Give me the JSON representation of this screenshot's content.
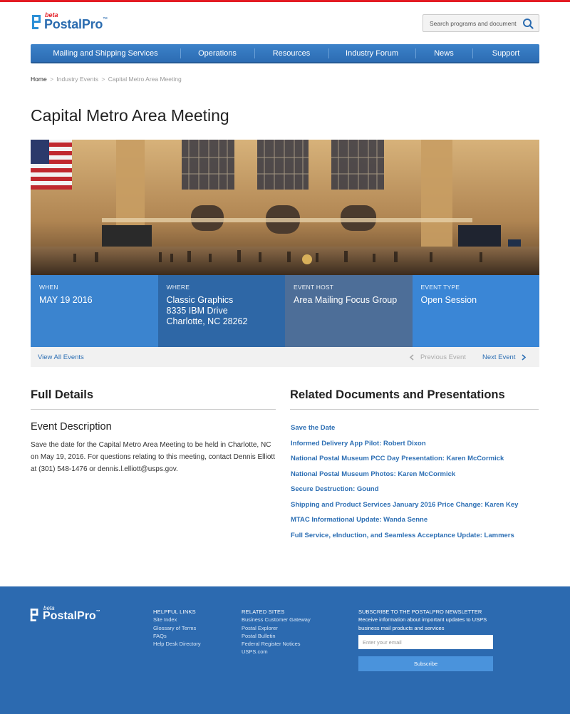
{
  "brand": {
    "beta": "beta",
    "name": "PostalPro",
    "tm": "™"
  },
  "search": {
    "placeholder": "Search programs and documents"
  },
  "nav": [
    "Mailing and Shipping Services",
    "Operations",
    "Resources",
    "Industry Forum",
    "News",
    "Support"
  ],
  "breadcrumb": {
    "home": "Home",
    "sep": ">",
    "level1": "Industry Events",
    "current": "Capital Metro Area Meeting"
  },
  "page_title": "Capital Metro Area Meeting",
  "event_info": {
    "when": {
      "label": "WHEN",
      "value": "MAY 19 2016"
    },
    "where": {
      "label": "WHERE",
      "line1": "Classic Graphics",
      "line2": "8335 IBM Drive",
      "line3": "Charlotte, NC 28262"
    },
    "host": {
      "label": "EVENT HOST",
      "value": "Area Mailing Focus Group"
    },
    "type": {
      "label": "EVENT TYPE",
      "value": "Open Session"
    }
  },
  "event_nav": {
    "view_all": "View All Events",
    "previous": "Previous Event",
    "next": "Next Event"
  },
  "details": {
    "heading": "Full Details",
    "desc_title": "Event Description",
    "desc": "Save the date for the Capital Metro Area Meeting to be held in Charlotte, NC on May 19, 2016. For questions relating to this meeting, contact Dennis Elliott at (301) 548-1476 or dennis.l.elliott@usps.gov."
  },
  "related": {
    "heading": "Related Documents and Presentations",
    "items": [
      "Save the Date",
      "Informed Delivery App Pilot: Robert Dixon",
      "National Postal Museum PCC Day Presentation: Karen McCormick",
      "National Postal Museum Photos: Karen McCormick",
      "Secure Destruction: Gound",
      "Shipping and Product Services January 2016 Price Change: Karen Key",
      "MTAC Informational Update: Wanda Senne",
      "Full Service, eInduction, and Seamless Acceptance Update: Lammers"
    ]
  },
  "footer": {
    "helpful": {
      "heading": "HELPFUL LINKS",
      "links": [
        "Site Index",
        "Glossary of Terms",
        "FAQs",
        "Help Desk Directory"
      ]
    },
    "related_sites": {
      "heading": "RELATED SITES",
      "links": [
        "Business Customer Gateway",
        "Postal Explorer",
        "Postal Bulletin",
        "Federal Register Notices",
        "USPS.com"
      ]
    },
    "newsletter": {
      "heading": "SUBSCRIBE TO THE POSTALPRO NEWSLETTER",
      "desc": "Receive information about important updates to USPS business mail products and services",
      "email_placeholder": "Enter your email",
      "button": "Subscribe"
    }
  },
  "colors": {
    "accent_red": "#e31b23",
    "brand_blue": "#2b6cb0",
    "link_blue": "#2d6fb4",
    "footer_blue": "#2c6ab0"
  }
}
